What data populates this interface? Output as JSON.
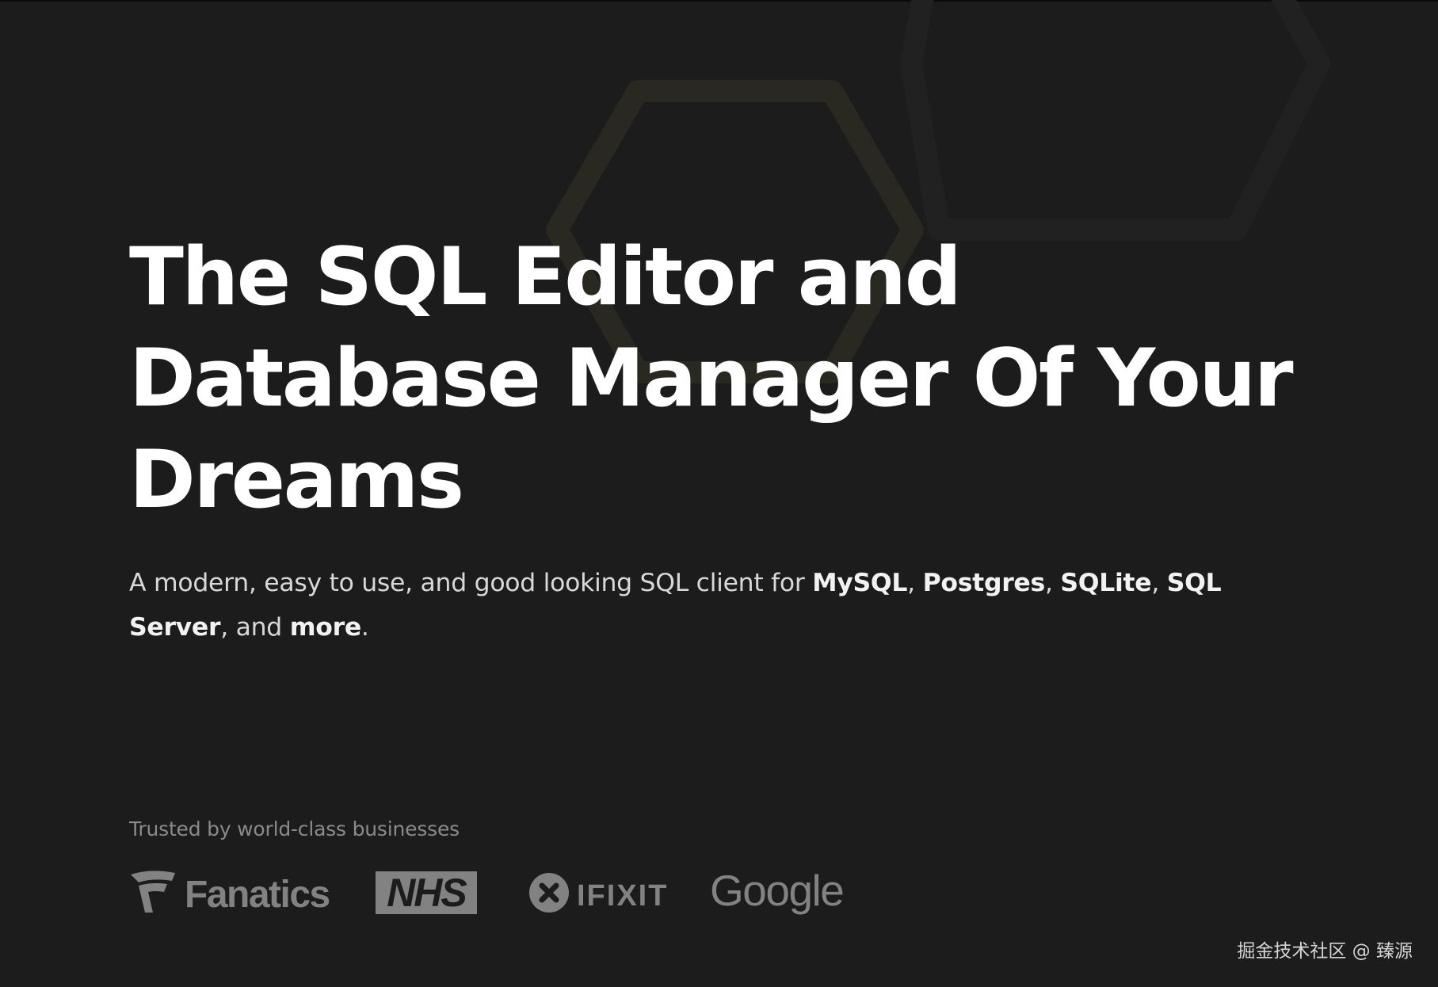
{
  "hero": {
    "title_lines": [
      "The SQL Editor and",
      "Database Manager Of Your",
      "Dreams"
    ],
    "subtitle": {
      "prefix": "A modern, easy to use, and good looking SQL client for ",
      "db_mysql": "MySQL",
      "sep1": ", ",
      "db_postgres": "Postgres",
      "sep2": ", ",
      "db_sqlite": "SQLite",
      "sep3": ", ",
      "db_sqlserver": "SQL Server",
      "sep4": ", and ",
      "more": "more",
      "suffix": "."
    }
  },
  "trusted": {
    "label": "Trusted by world-class businesses",
    "logos": {
      "fanatics": "Fanatics",
      "nhs": "NHS",
      "ifixit": "IFIXIT",
      "google": "Google"
    }
  },
  "watermark": "掘金技术社区 @ 臻源",
  "colors": {
    "background": "#1c1c1c",
    "title": "#ffffff",
    "subtitle": "#d8d8d8",
    "muted": "#8a8a8a",
    "logo": "#828282",
    "hexagon_outline": "#2a2a24"
  }
}
